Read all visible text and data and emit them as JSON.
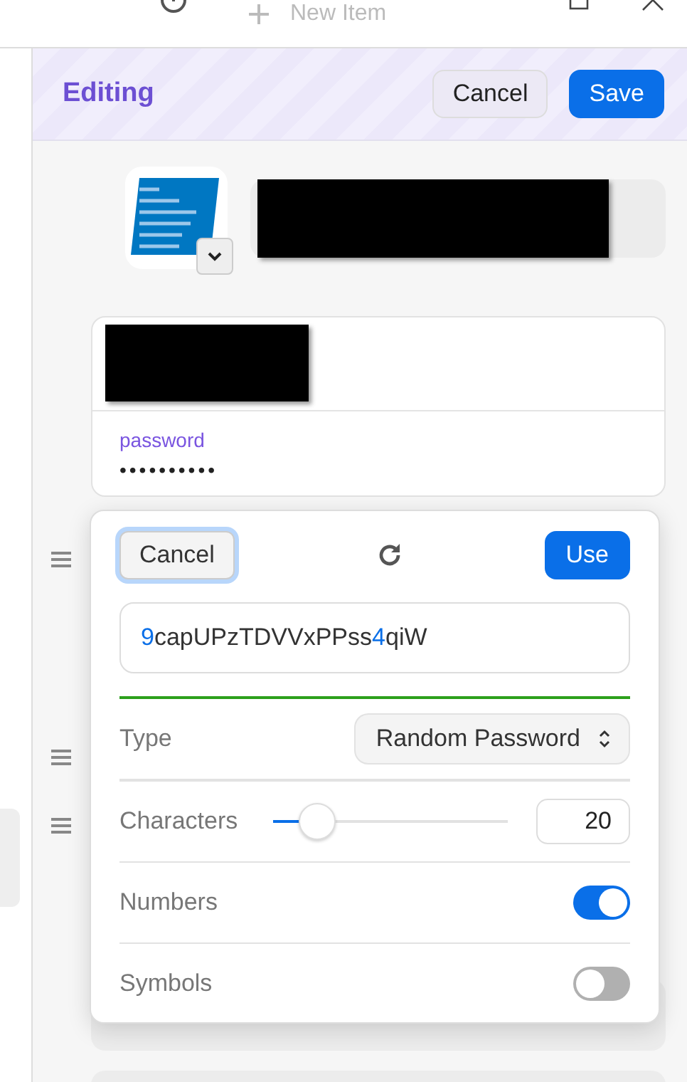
{
  "top_bar": {
    "new_item": "New Item"
  },
  "header": {
    "title": "Editing",
    "cancel": "Cancel",
    "save": "Save"
  },
  "login_card": {
    "password_label": "password",
    "password_value": "••••••••••"
  },
  "generator": {
    "cancel": "Cancel",
    "use": "Use",
    "password": [
      {
        "text": "9",
        "kind": "digit"
      },
      {
        "text": "capUPzTDVVxPPss",
        "kind": "letters"
      },
      {
        "text": "4",
        "kind": "digit"
      },
      {
        "text": "qiW",
        "kind": "letters"
      }
    ],
    "type_label": "Type",
    "type_value": "Random Password",
    "characters_label": "Characters",
    "characters": {
      "level": 0.19
    },
    "characters_value": "20",
    "toggles": [
      {
        "label": "Numbers",
        "on": true
      },
      {
        "label": "Symbols",
        "on": false
      }
    ]
  }
}
